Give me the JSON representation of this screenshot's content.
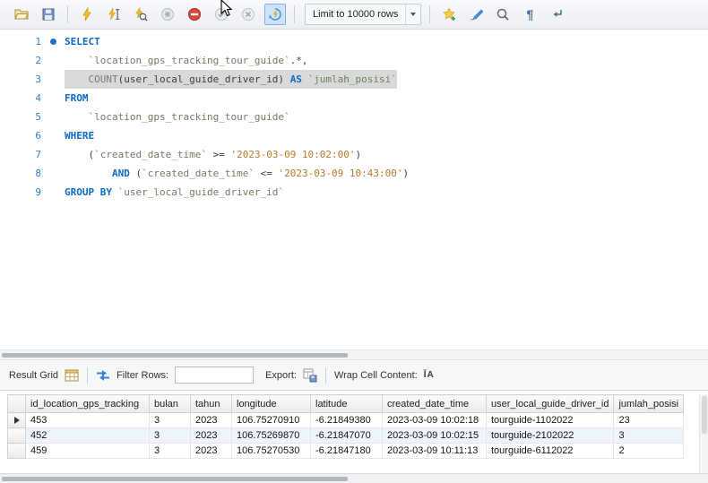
{
  "toolbar": {
    "limit_dropdown_label": "Limit to 10000 rows",
    "icons": [
      "open-sql-file",
      "save-script",
      "execute",
      "execute-current-statement",
      "explain",
      "stop-query",
      "toggle-stop-on-error",
      "commit",
      "rollback",
      "toggle-autocommit",
      "new-snippet",
      "beautify-sql",
      "find",
      "show-invisibles",
      "toggle-wrap"
    ]
  },
  "icons": {
    "pilcrow_glyph": "¶",
    "wrap_cell_glyph": "ĪA"
  },
  "editor": {
    "lines": [
      {
        "num": "1",
        "marker": true,
        "segments": [
          {
            "t": "kw",
            "v": "SELECT"
          }
        ]
      },
      {
        "num": "2",
        "segments": [
          {
            "t": "pl",
            "v": "    "
          },
          {
            "t": "id",
            "v": "`location_gps_tracking_tour_guide`"
          },
          {
            "t": "pl",
            "v": ".*,"
          }
        ]
      },
      {
        "num": "3",
        "highlight": true,
        "segments": [
          {
            "t": "pl",
            "v": "    "
          },
          {
            "t": "fn",
            "v": "COUNT"
          },
          {
            "t": "pl",
            "v": "(user_local_guide_driver_id) "
          },
          {
            "t": "kw",
            "v": "AS"
          },
          {
            "t": "pl",
            "v": " "
          },
          {
            "t": "id",
            "v": "`jumlah_posisi`"
          }
        ]
      },
      {
        "num": "4",
        "segments": [
          {
            "t": "kw",
            "v": "FROM"
          }
        ]
      },
      {
        "num": "5",
        "segments": [
          {
            "t": "pl",
            "v": "    "
          },
          {
            "t": "id",
            "v": "`location_gps_tracking_tour_guide`"
          }
        ]
      },
      {
        "num": "6",
        "segments": [
          {
            "t": "kw",
            "v": "WHERE"
          }
        ]
      },
      {
        "num": "7",
        "segments": [
          {
            "t": "pl",
            "v": "    ("
          },
          {
            "t": "id",
            "v": "`created_date_time`"
          },
          {
            "t": "pl",
            "v": " >= "
          },
          {
            "t": "str",
            "v": "'2023-03-09 10:02:00'"
          },
          {
            "t": "pl",
            "v": ")"
          }
        ]
      },
      {
        "num": "8",
        "segments": [
          {
            "t": "pl",
            "v": "        "
          },
          {
            "t": "kw",
            "v": "AND"
          },
          {
            "t": "pl",
            "v": " ("
          },
          {
            "t": "id",
            "v": "`created_date_time`"
          },
          {
            "t": "pl",
            "v": " <= "
          },
          {
            "t": "str",
            "v": "'2023-03-09 10:43:00'"
          },
          {
            "t": "pl",
            "v": ")"
          }
        ]
      },
      {
        "num": "9",
        "segments": [
          {
            "t": "kw",
            "v": "GROUP BY"
          },
          {
            "t": "pl",
            "v": " "
          },
          {
            "t": "id",
            "v": "`user_local_guide_driver_id`"
          }
        ]
      }
    ]
  },
  "result_toolbar": {
    "title": "Result Grid",
    "filter_label": "Filter Rows:",
    "filter_value": "",
    "export_label": "Export:",
    "wrap_label": "Wrap Cell Content:"
  },
  "grid": {
    "columns": [
      "id_location_gps_tracking",
      "bulan",
      "tahun",
      "longitude",
      "latitude",
      "created_date_time",
      "user_local_guide_driver_id",
      "jumlah_posisi"
    ],
    "rows": [
      [
        "453",
        "3",
        "2023",
        "106.75270910",
        "-6.21849380",
        "2023-03-09 10:02:18",
        "tourguide-1102022",
        "23"
      ],
      [
        "452",
        "3",
        "2023",
        "106.75269870",
        "-6.21847070",
        "2023-03-09 10:02:15",
        "tourguide-2102022",
        "3"
      ],
      [
        "459",
        "3",
        "2023",
        "106.75270530",
        "-6.21847180",
        "2023-03-09 10:11:13",
        "tourguide-6112022",
        "2"
      ]
    ]
  },
  "colors": {
    "keyword": "#0a6bc8",
    "identifier": "#6b7f63",
    "string": "#b87a2e",
    "function": "#7a7a7a",
    "plain": "#3c3c3c",
    "line_number": "#2e7fd0",
    "alt_row": "#eef4fb",
    "line_highlight": "#d9d9d9",
    "selection_highlight": "#cfe3f7"
  }
}
